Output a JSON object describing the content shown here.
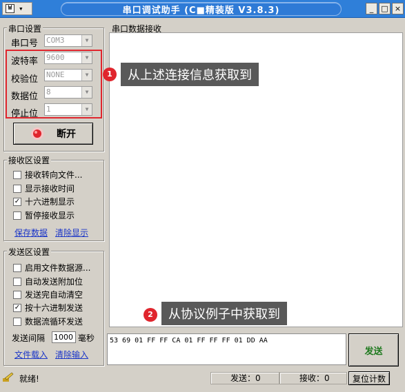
{
  "window": {
    "sysmenu_logo": "W",
    "sysmenu_arrow": "▾",
    "title": "串口调试助手 (C■精装版 V3.8.3)",
    "controls": [
      "_",
      "□",
      "×"
    ]
  },
  "port_settings": {
    "title": "串口设置",
    "fields": [
      {
        "label": "串口号",
        "value": "COM3"
      },
      {
        "label": "波特率",
        "value": "9600"
      },
      {
        "label": "校验位",
        "value": "NONE"
      },
      {
        "label": "数据位",
        "value": "8"
      },
      {
        "label": "停止位",
        "value": "1"
      }
    ],
    "button_label": "断开",
    "indicator_color": "#e0252d"
  },
  "receive_settings": {
    "title": "接收区设置",
    "options": [
      {
        "label": "接收转向文件...",
        "checked": false
      },
      {
        "label": "显示接收时间",
        "checked": false
      },
      {
        "label": "十六进制显示",
        "checked": true
      },
      {
        "label": "暂停接收显示",
        "checked": false
      }
    ],
    "links": [
      "保存数据",
      "清除显示"
    ]
  },
  "send_settings": {
    "title": "发送区设置",
    "options": [
      {
        "label": "启用文件数据源...",
        "checked": false
      },
      {
        "label": "自动发送附加位",
        "checked": false
      },
      {
        "label": "发送完自动清空",
        "checked": false
      },
      {
        "label": "按十六进制发送",
        "checked": true
      },
      {
        "label": "数据流循环发送",
        "checked": false
      }
    ],
    "interval_label": "发送间隔",
    "interval_value": "1000",
    "interval_unit": "毫秒",
    "links": [
      "文件载入",
      "清除输入"
    ]
  },
  "receive_panel": {
    "title": "串口数据接收"
  },
  "annotations": [
    {
      "number": "1",
      "text": "从上述连接信息获取到"
    },
    {
      "number": "2",
      "text": "从协议例子中获取到"
    }
  ],
  "send_panel": {
    "data": "53 69 01 FF FF CA 01 FF FF FF 01 DD AA",
    "send_button": "发送"
  },
  "status_bar": {
    "status": "就绪!",
    "sent": "发送：0",
    "received": "接收：0",
    "reset_button": "复位计数"
  },
  "colors": {
    "title_bar": "#2f7fd9",
    "highlight_border": "#e0252d",
    "callout_bg": "#595959",
    "link": "#1a35c8",
    "send_text": "#1f7a1f"
  }
}
